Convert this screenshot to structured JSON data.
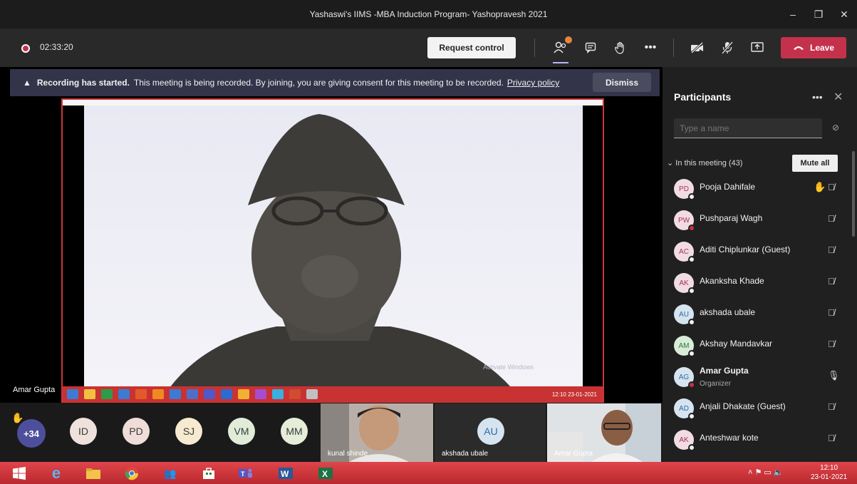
{
  "window": {
    "title": "Yashaswi's IIMS -MBA Induction Program- Yashopravesh 2021",
    "controls": [
      "–",
      "❐",
      "✕"
    ]
  },
  "meeting_bar": {
    "timer": "02:33:20",
    "request_control_label": "Request control",
    "leave_label": "Leave",
    "participants_badge": "1"
  },
  "banner": {
    "bold": "Recording has started.",
    "message": "This meeting is being recorded. By joining, you are giving consent for this meeting to be recorded.",
    "link": "Privacy policy",
    "dismiss_label": "Dismiss"
  },
  "stage": {
    "presenter_name": "Amar Gupta",
    "shared_clock": "12:10 23-01-2021"
  },
  "gallery": {
    "more_count": "+34",
    "avatars": [
      {
        "initials": "ID",
        "bg": "#efe2dc"
      },
      {
        "initials": "PD",
        "bg": "#f0dcd8"
      },
      {
        "initials": "SJ",
        "bg": "#f6ead0"
      },
      {
        "initials": "VM",
        "bg": "#e0ecd8"
      },
      {
        "initials": "MM",
        "bg": "#e6edd8"
      }
    ],
    "tiles": [
      {
        "name": "kunal shinde"
      },
      {
        "name": "akshada ubale",
        "initials": "AU"
      },
      {
        "name": "Amar Gupta"
      }
    ]
  },
  "participants": {
    "title": "Participants",
    "search_placeholder": "Type a name",
    "section_label": "In this meeting (43)",
    "mute_all_label": "Mute all",
    "list": [
      {
        "initials": "PD",
        "name": "Pooja Dahifale",
        "color": "pink",
        "hand": true
      },
      {
        "initials": "PW",
        "name": "Pushparaj Wagh",
        "color": "pink"
      },
      {
        "initials": "AC",
        "name": "Aditi Chiplunkar (Guest)",
        "color": "pink"
      },
      {
        "initials": "AK",
        "name": "Akanksha Khade",
        "color": "pink"
      },
      {
        "initials": "AU",
        "name": "akshada ubale",
        "color": "blue"
      },
      {
        "initials": "AM",
        "name": "Akshay Mandavkar",
        "color": "green"
      },
      {
        "initials": "AG",
        "name": "Amar Gupta",
        "role": "Organizer",
        "color": "blue"
      },
      {
        "initials": "AD",
        "name": "Anjali Dhakate (Guest)",
        "color": "blue"
      },
      {
        "initials": "AK",
        "name": "Anteshwar kote",
        "color": "pink"
      }
    ]
  },
  "taskbar": {
    "time": "12:10",
    "date": "23-01-2021"
  }
}
